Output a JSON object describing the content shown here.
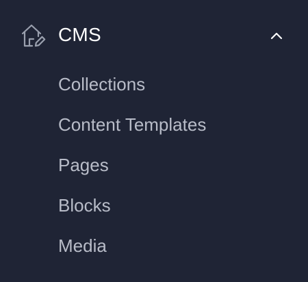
{
  "nav": {
    "section": {
      "title": "CMS",
      "icon": "home-edit-icon",
      "expanded": true,
      "toggle_icon": "chevron-up-icon"
    },
    "items": [
      {
        "label": "Collections"
      },
      {
        "label": "Content Templates"
      },
      {
        "label": "Pages"
      },
      {
        "label": "Blocks"
      },
      {
        "label": "Media"
      }
    ]
  },
  "colors": {
    "background": "#1f2435",
    "title": "#ffffff",
    "item_text": "#b8bcc8",
    "icon": "#9aa0ae"
  }
}
